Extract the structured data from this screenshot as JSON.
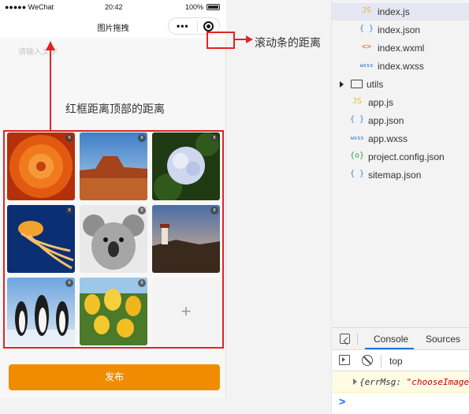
{
  "phone": {
    "status": {
      "signal": "●●●●● WeChat",
      "time": "20:42",
      "battery": "100%"
    },
    "nav_title": "图片拖拽",
    "textarea_placeholder": "请输入文字",
    "images": [
      {
        "name": "orange-flower-photo",
        "deletable": true
      },
      {
        "name": "desert-mesa-photo",
        "deletable": true
      },
      {
        "name": "hydrangea-photo",
        "deletable": true
      },
      {
        "name": "jellyfish-photo",
        "deletable": true
      },
      {
        "name": "koala-photo",
        "deletable": true
      },
      {
        "name": "lighthouse-photo",
        "deletable": true
      },
      {
        "name": "penguins-photo",
        "deletable": true
      },
      {
        "name": "tulips-photo",
        "deletable": true
      }
    ],
    "delete_label": "x",
    "add_label": "+",
    "publish_label": "发布",
    "accent": "#f08c00"
  },
  "annotations": {
    "grid_label": "红框距离顶部的距离",
    "scroll_label": "滚动条的距离",
    "color": "#e02424"
  },
  "file_tree": [
    {
      "icon": "JS",
      "icon_color": "#e8b43a",
      "name": "index.js",
      "indent": 2,
      "active": true
    },
    {
      "icon": "{ }",
      "icon_color": "#2b8fd6",
      "name": "index.json",
      "indent": 2,
      "active": false
    },
    {
      "icon": "<>",
      "icon_color": "#e5632c",
      "name": "index.wxml",
      "indent": 2,
      "active": false
    },
    {
      "icon": "wxss",
      "icon_color": "#2b6cd6",
      "name": "index.wxss",
      "indent": 2,
      "active": false
    },
    {
      "icon": "folder",
      "icon_color": "#555555",
      "name": "utils",
      "indent": 0,
      "active": false
    },
    {
      "icon": "JS",
      "icon_color": "#e8b43a",
      "name": "app.js",
      "indent": 1,
      "active": false
    },
    {
      "icon": "{ }",
      "icon_color": "#2b8fd6",
      "name": "app.json",
      "indent": 1,
      "active": false
    },
    {
      "icon": "wxss",
      "icon_color": "#2b6cd6",
      "name": "app.wxss",
      "indent": 1,
      "active": false
    },
    {
      "icon": "{o}",
      "icon_color": "#2aa14d",
      "name": "project.config.json",
      "indent": 1,
      "active": false
    },
    {
      "icon": "{ }",
      "icon_color": "#2b8fd6",
      "name": "sitemap.json",
      "indent": 1,
      "active": false
    }
  ],
  "devtools": {
    "tabs": [
      "Console",
      "Sources"
    ],
    "active_tab": "Console",
    "context": "top",
    "log_key": "{errMsg: ",
    "log_value": "\"chooseImage",
    "prompt": ">"
  }
}
